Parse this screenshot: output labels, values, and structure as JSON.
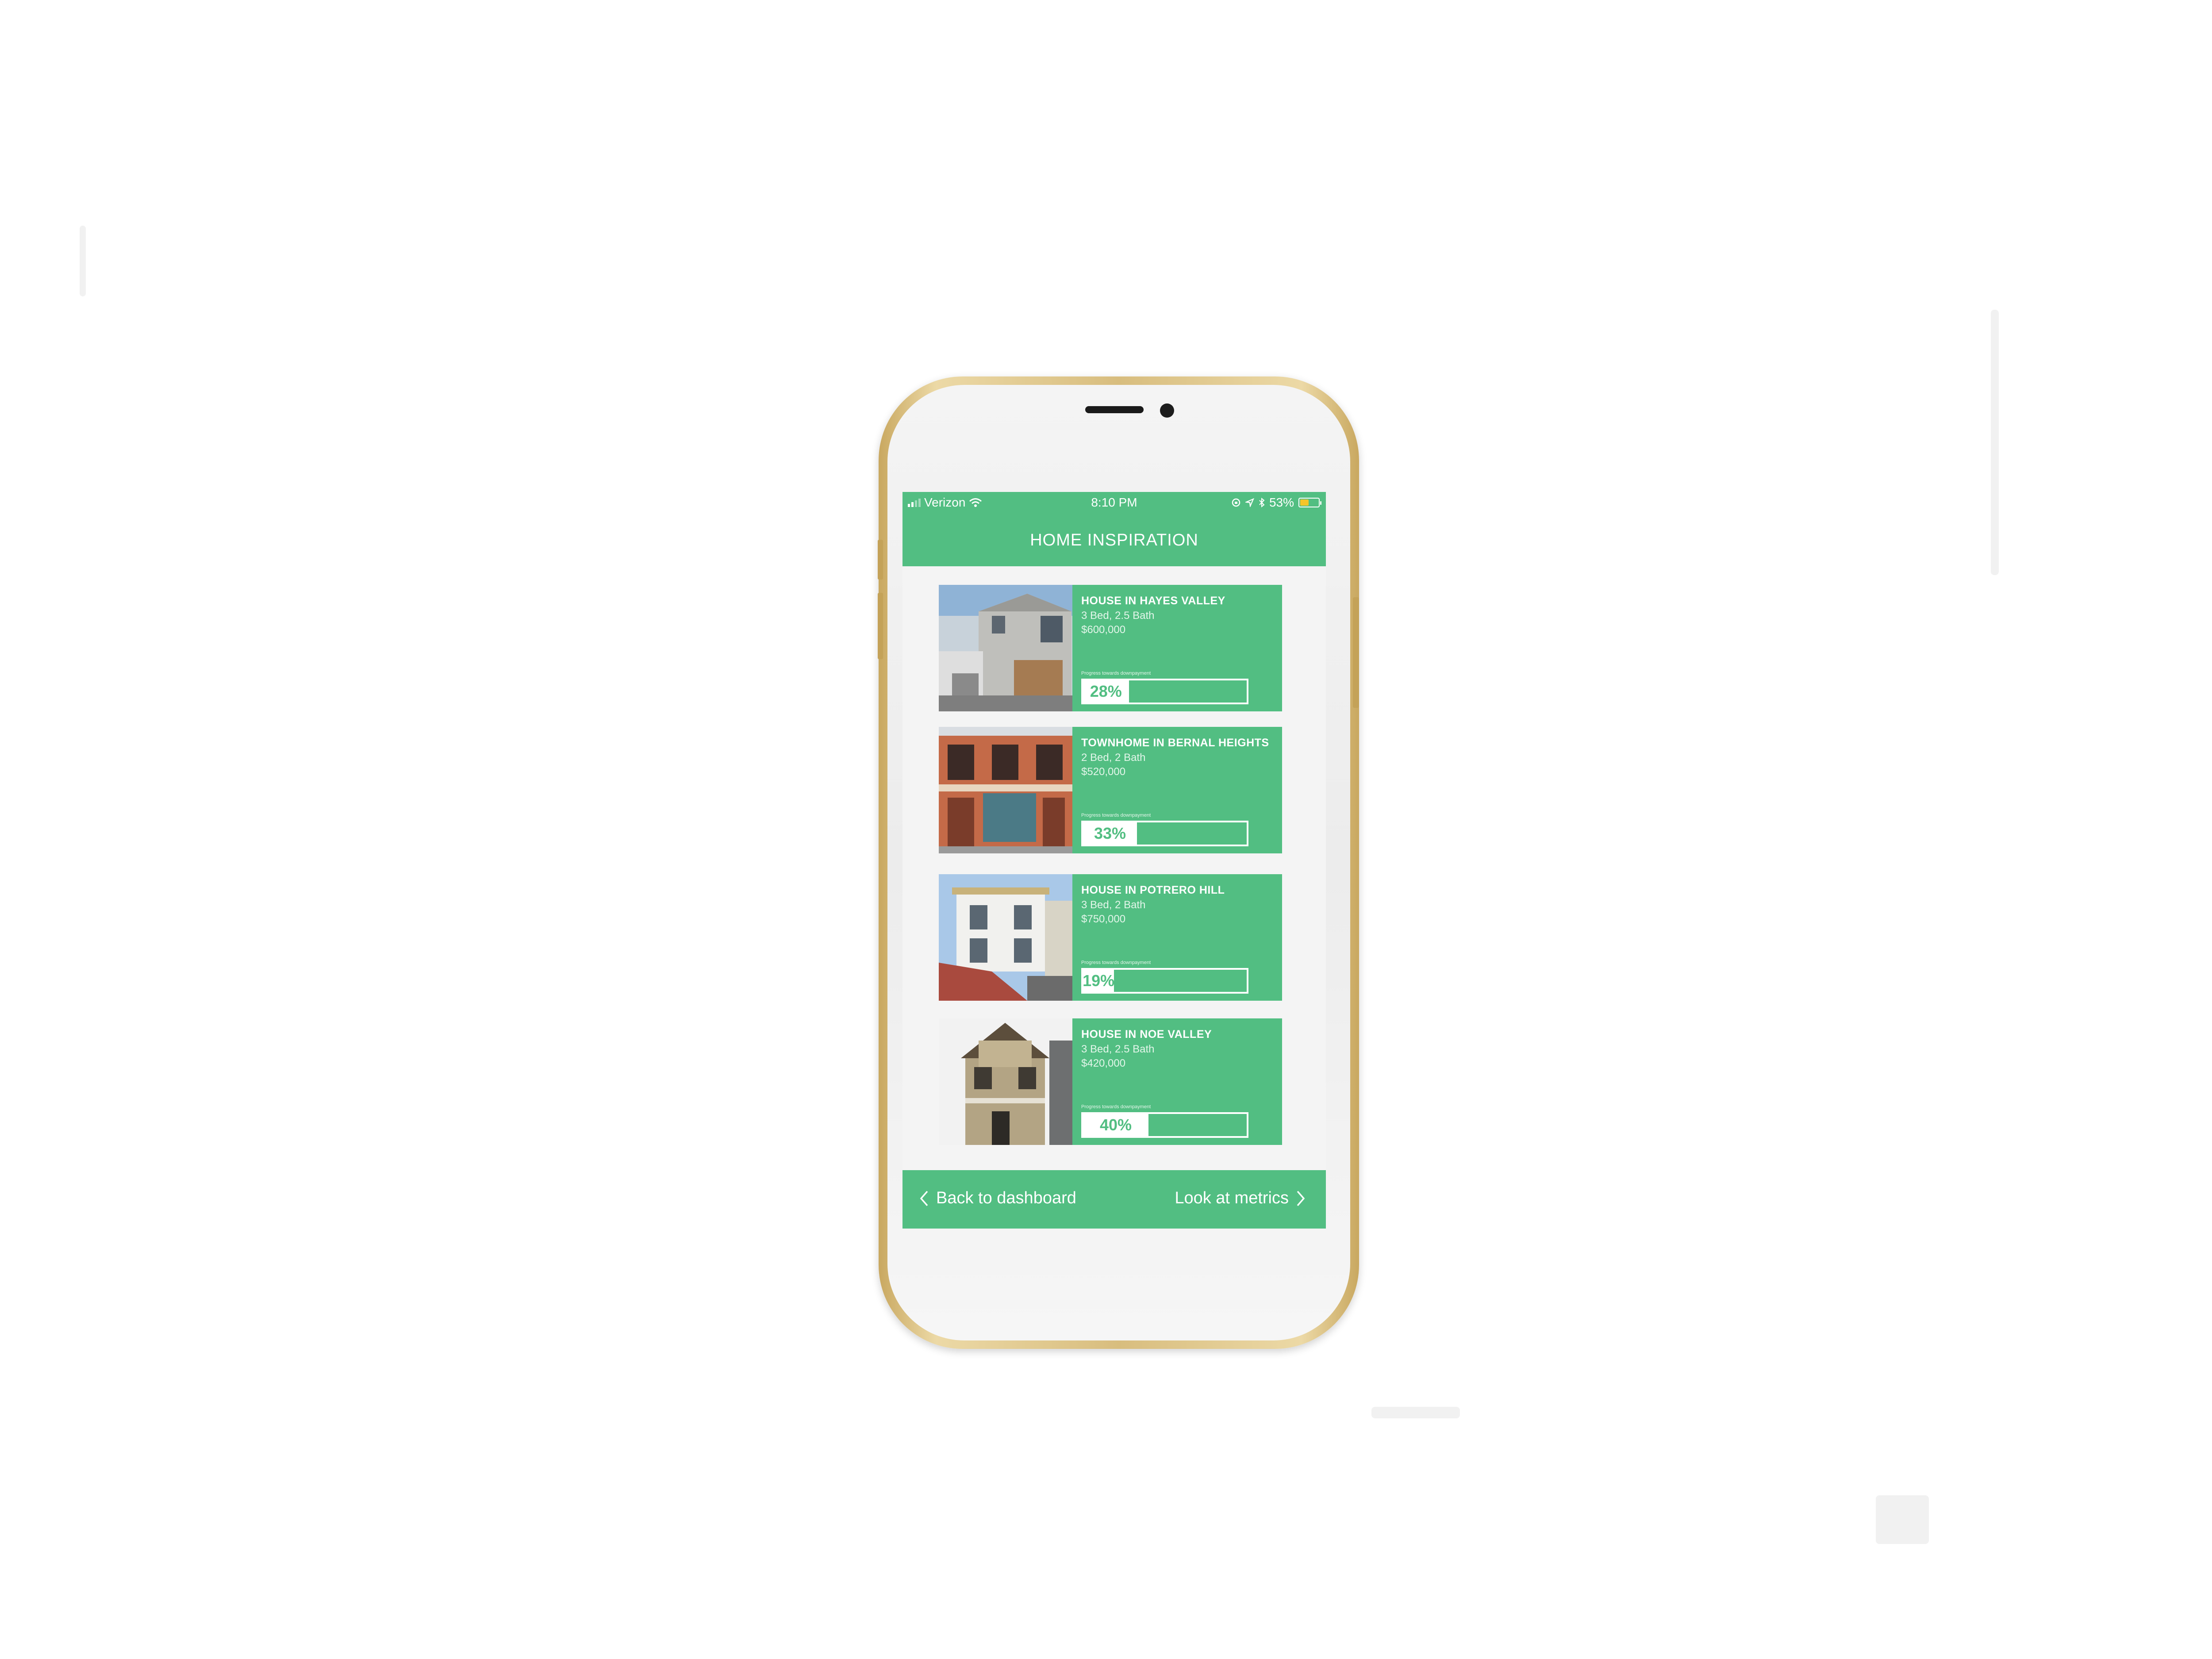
{
  "status_bar": {
    "carrier": "Verizon",
    "time": "8:10 PM",
    "battery": "53%",
    "battery_color": "#f6c52a",
    "battery_level": 0.53,
    "icons": [
      "signal-icon",
      "wifi-icon",
      "lock-rotation-icon",
      "location-arrow-icon",
      "bluetooth-icon",
      "battery-icon"
    ]
  },
  "header": {
    "title": "HOME INSPIRATION"
  },
  "theme": {
    "accent": "#52be82",
    "background": "#f4f4f4",
    "phone_frame": "#d8bd7e"
  },
  "listings": [
    {
      "title": "HOUSE IN HAYES VALLEY",
      "beds": "3 Bed, 2.5 Bath",
      "price": "$600,000",
      "progress_label": "Progress towards downpayment",
      "progress_text": "28%",
      "progress": 0.28
    },
    {
      "title": "TOWNHOME IN BERNAL HEIGHTS",
      "beds": "2 Bed, 2 Bath",
      "price": "$520,000",
      "progress_label": "Progress towards downpayment",
      "progress_text": "33%",
      "progress": 0.33
    },
    {
      "title": "HOUSE IN POTRERO HILL",
      "beds": "3 Bed, 2 Bath",
      "price": "$750,000",
      "progress_label": "Progress towards downpayment",
      "progress_text": "19%",
      "progress": 0.19
    },
    {
      "title": "HOUSE IN NOE VALLEY",
      "beds": "3 Bed, 2.5 Bath",
      "price": "$420,000",
      "progress_label": "Progress towards downpayment",
      "progress_text": "40%",
      "progress": 0.4
    }
  ],
  "footer": {
    "back_label": "Back to dashboard",
    "next_label": "Look at metrics"
  }
}
